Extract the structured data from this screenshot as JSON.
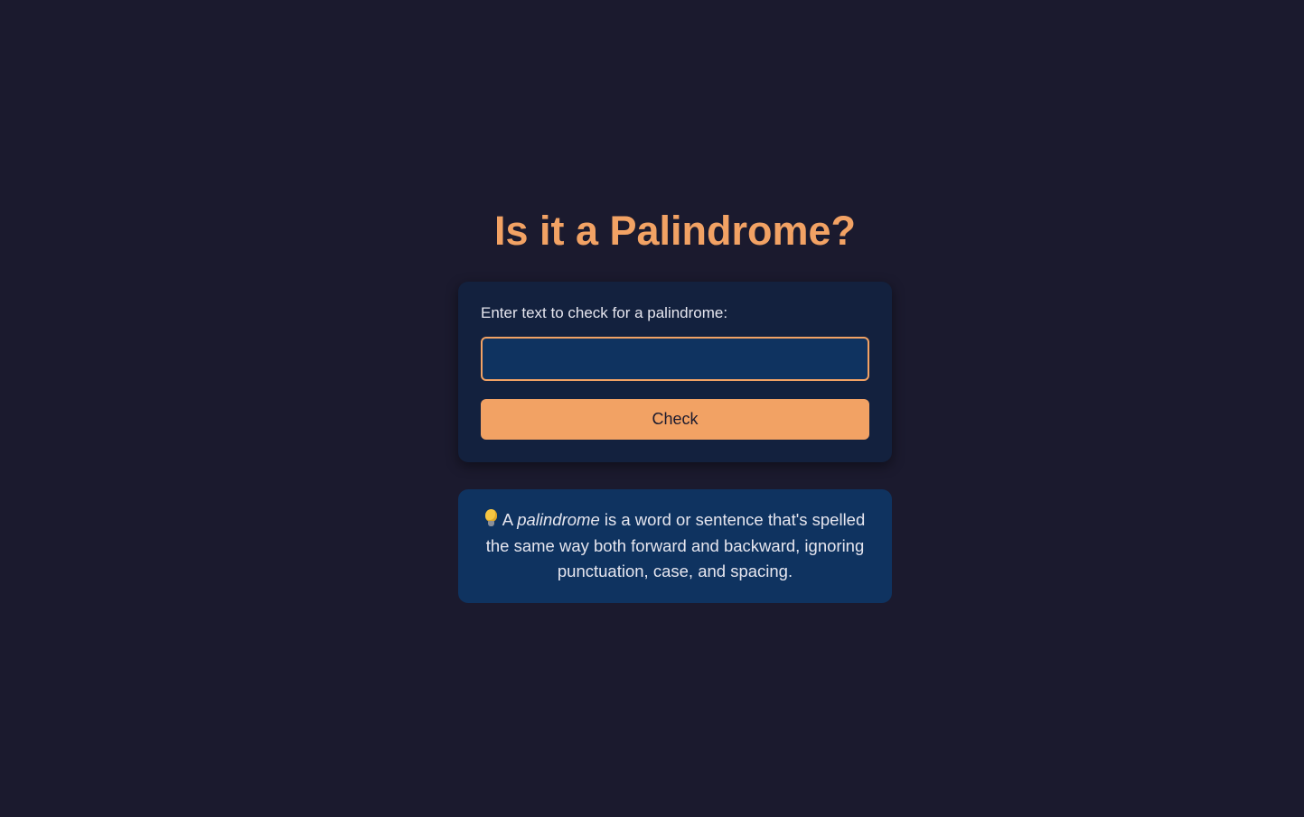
{
  "page": {
    "title": "Is it a Palindrome?"
  },
  "form": {
    "label": "Enter text to check for a palindrome:",
    "input_value": "",
    "input_placeholder": "",
    "button_label": "Check"
  },
  "info": {
    "icon": "lightbulb-icon",
    "text_before": "A",
    "emphasis": "palindrome",
    "text_after": "is a word or sentence that's spelled the same way both forward and backward, ignoring punctuation, case, and spacing."
  },
  "colors": {
    "background": "#1b1a2e",
    "accent": "#f2a264",
    "card": "#13213e",
    "input_background": "#0f3360",
    "info_background": "#0f3360",
    "text": "#e6e6ef"
  }
}
